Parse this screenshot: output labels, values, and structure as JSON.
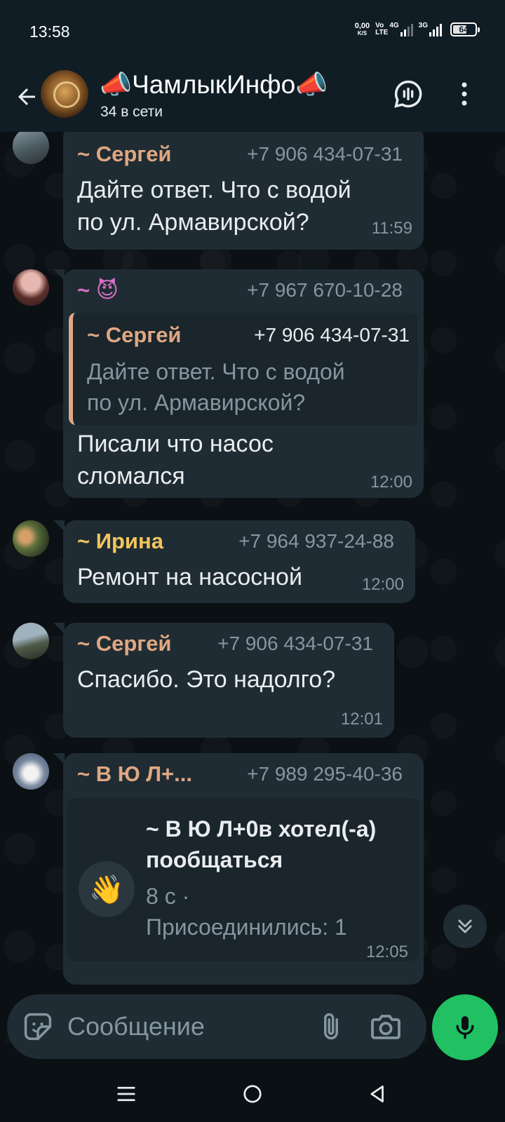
{
  "status_bar": {
    "time": "13:58",
    "net_speed": "0,00",
    "net_speed_unit": "K/S",
    "signal1_top": "Vo",
    "signal1_bottom": "LTE",
    "signal1_type": "4G",
    "signal2_type": "3G",
    "battery_level": "64"
  },
  "header": {
    "title": "📣ЧамлыкИнфо📣",
    "subtitle": "34 в сети"
  },
  "messages": [
    {
      "sender": "~ Сергей",
      "sender_color": "#e0a782",
      "phone": "+7 906 434-07-31",
      "text_line1": "Дайте ответ. Что с водой",
      "text_line2": "по ул. Армавирской?",
      "time": "11:59"
    },
    {
      "sender": "~ 😈",
      "sender_color": "#d66fc7",
      "phone": "+7 967 670-10-28",
      "quote_sender": "~ Сергей",
      "quote_phone": "+7 906 434-07-31",
      "quote_line1": "Дайте ответ. Что с водой",
      "quote_line2": "по ул. Армавирской?",
      "text_line1": "Писали что насос",
      "text_line2": "сломался",
      "time": "12:00"
    },
    {
      "sender": "~ Ирина",
      "sender_color": "#f2c55c",
      "phone": "+7 964 937-24-88",
      "text_line1": "Ремонт на насосной",
      "time": "12:00"
    },
    {
      "sender": "~ Сергей",
      "sender_color": "#e0a782",
      "phone": "+7 906 434-07-31",
      "text_line1": "Спасибо. Это надолго?",
      "time": "12:01"
    },
    {
      "sender": "~ В  Ю Л+...",
      "sender_color": "#e0a782",
      "phone": "+7 989 295-40-36",
      "call_title_line1": "~ В  Ю Л+0в хотел(-а)",
      "call_title_line2": "пообщаться",
      "call_emoji": "👋",
      "call_duration": "8 с ·",
      "call_joined": "Присоединились: 1",
      "time": "12:05"
    }
  ],
  "input": {
    "placeholder": "Сообщение"
  },
  "colors": {
    "accent_green": "#21c063",
    "bubble_bg": "#1f2c33",
    "header_bg": "#101d25"
  }
}
